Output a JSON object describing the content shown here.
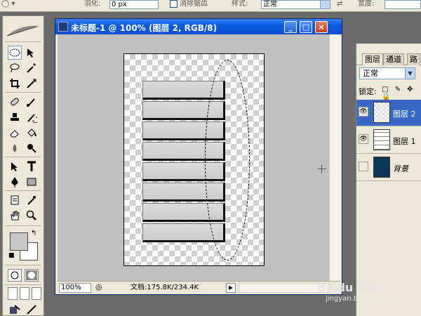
{
  "optionsbar": {
    "feather_label": "羽化:",
    "feather_value": "0 px",
    "antialias_label": "消除锯齿",
    "style_label": "样式:",
    "style_value": "正常",
    "width_label": "宽度:"
  },
  "document": {
    "title": "未标题-1 @ 100% (图层 2, RGB/8)",
    "zoom": "100%",
    "docinfo": "文档:175.8K/234.4K",
    "stripes": 8
  },
  "layers_panel": {
    "tabs": [
      {
        "label": "图层"
      },
      {
        "label": "通道"
      },
      {
        "label": "路"
      }
    ],
    "blend_mode": "正常",
    "lock_label": "锁定:",
    "lock_icons": "□ ✎ ✥ 🔒",
    "layers": [
      {
        "name": "图层 2",
        "visible": true,
        "selected": true
      },
      {
        "name": "图层 1",
        "visible": true,
        "selected": false
      },
      {
        "name": "背景",
        "visible": false,
        "selected": false
      }
    ]
  },
  "watermark": {
    "brand": "Baidu 经验",
    "url": "jingyan.baidu.com"
  },
  "colors": {
    "title_bar": "#0b4fd0",
    "selected_layer": "#3869c7",
    "background_layer": "#0c3556",
    "foreground_swatch": "#c8c8c8",
    "background_swatch": "#ffffff"
  }
}
